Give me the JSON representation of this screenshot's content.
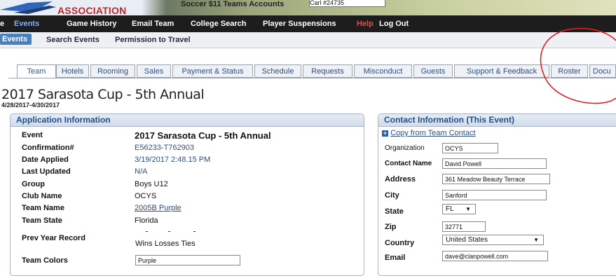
{
  "header": {
    "logo_text": "ASSOCIATION",
    "partial_text": "Soccer  $11  Teams  Accounts",
    "account_select": "Carl #24735"
  },
  "nav": {
    "items": [
      {
        "label": "e"
      },
      {
        "label": "Events"
      },
      {
        "label": "Game History"
      },
      {
        "label": "Email Team"
      },
      {
        "label": "College Search"
      },
      {
        "label": "Player Suspensions"
      },
      {
        "label": "Help"
      },
      {
        "label": "Log Out"
      }
    ]
  },
  "subnav": {
    "items": [
      {
        "label": "Events"
      },
      {
        "label": "Search Events"
      },
      {
        "label": "Permission to Travel"
      }
    ]
  },
  "tabs": [
    {
      "label": "Team"
    },
    {
      "label": "Hotels"
    },
    {
      "label": "Rooming"
    },
    {
      "label": "Sales"
    },
    {
      "label": "Payment & Status"
    },
    {
      "label": "Schedule"
    },
    {
      "label": "Requests"
    },
    {
      "label": "Misconduct"
    },
    {
      "label": "Guests"
    },
    {
      "label": "Support & Feedback"
    },
    {
      "label": "Roster"
    },
    {
      "label": "Docu"
    }
  ],
  "page": {
    "title": "2017 Sarasota Cup - 5th Annual",
    "dates": "4/28/2017-4/30/2017"
  },
  "application": {
    "heading": "Application Information",
    "rows": [
      {
        "label": "Event",
        "value": "2017 Sarasota Cup - 5th Annual"
      },
      {
        "label": "Confirmation#",
        "value": "E56233-T762903"
      },
      {
        "label": "Date Applied",
        "value": "3/19/2017 2:48.15 PM"
      },
      {
        "label": "Last Updated",
        "value": "N/A"
      },
      {
        "label": "Group",
        "value": "Boys U12"
      },
      {
        "label": "Club Name",
        "value": "OCYS"
      },
      {
        "label": "Team Name",
        "value": "2005B Purple"
      },
      {
        "label": "Team State",
        "value": "Florida"
      },
      {
        "label": "Prev Year Record",
        "value": "Wins Losses Ties"
      },
      {
        "label": "Team Colors",
        "value": "Purple"
      }
    ]
  },
  "contact": {
    "heading": "Contact Information (This Event)",
    "copy_link": "Copy from Team Contact",
    "fields": [
      {
        "label": "Organization",
        "value": "OCYS"
      },
      {
        "label": "Contact Name",
        "value": "David Powell"
      },
      {
        "label": "Address",
        "value": "361 Meadow Beauty Terrace"
      },
      {
        "label": "City",
        "value": "Sanford"
      },
      {
        "label": "State",
        "value": "FL"
      },
      {
        "label": "Zip",
        "value": "32771"
      },
      {
        "label": "Country",
        "value": "United States"
      },
      {
        "label": "Email",
        "value": "dave@clanpowell.com"
      }
    ]
  },
  "colors": {
    "nav_bg": "#1d1d1d",
    "help": "#e05050",
    "link": "#2c4f86",
    "annotation": "#e02020"
  }
}
